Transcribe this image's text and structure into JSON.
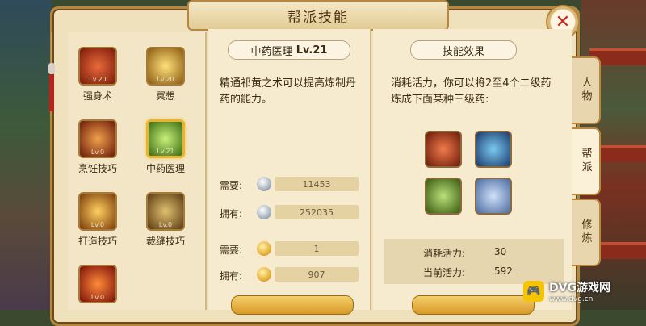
{
  "window": {
    "title": "帮派技能",
    "close_label": "✕"
  },
  "skills": [
    {
      "name": "强身术",
      "level": "Lv.20",
      "selected": false,
      "icon": "fire-beast-icon",
      "color": "#b5341c"
    },
    {
      "name": "冥想",
      "level": "Lv.20",
      "selected": false,
      "icon": "golden-aura-icon",
      "color": "#c98a1a"
    },
    {
      "name": "烹饪技巧",
      "level": "Lv.0",
      "selected": false,
      "icon": "cooking-pot-icon",
      "color": "#a6381c"
    },
    {
      "name": "中药医理",
      "level": "Lv.21",
      "selected": true,
      "icon": "green-herb-icon",
      "color": "#6aa82a"
    },
    {
      "name": "打造技巧",
      "level": "Lv.0",
      "selected": false,
      "icon": "forge-hammer-icon",
      "color": "#b06a14"
    },
    {
      "name": "裁缝技巧",
      "level": "Lv.0",
      "selected": false,
      "icon": "sewing-icon",
      "color": "#8a6a24"
    },
    {
      "name": "",
      "level": "Lv.0",
      "selected": false,
      "icon": "flame-orb-icon",
      "color": "#b8301a"
    }
  ],
  "detail": {
    "title": "中药医理",
    "level": "Lv.21",
    "description": "精通祁黄之术可以提高炼制丹药的能力。",
    "need_label": "需要:",
    "have_label": "拥有:",
    "silver_need": "11453",
    "silver_have": "252035",
    "gold_need": "1",
    "gold_have": "907"
  },
  "effect": {
    "title": "技能效果",
    "description": "消耗活力，你可以将2至4个二级药炼成下面某种三级药:",
    "items": [
      {
        "icon": "red-pouch-icon",
        "color": "#c43a24"
      },
      {
        "icon": "blue-bowl-icon",
        "color": "#2c74b8"
      },
      {
        "icon": "herb-beads-icon",
        "color": "#5a8a2a"
      },
      {
        "icon": "potion-bottle-icon",
        "color": "#7aa0d8"
      }
    ],
    "cost_label": "消耗活力:",
    "cost_value": "30",
    "current_label": "当前活力:",
    "current_value": "592"
  },
  "side_tabs": [
    {
      "label": "人物",
      "active": false
    },
    {
      "label": "帮派",
      "active": true
    },
    {
      "label": "修炼",
      "active": false
    }
  ],
  "watermark": {
    "brand": "DVG游戏网",
    "url": "www.dvg.cn",
    "logo": "DVG"
  }
}
